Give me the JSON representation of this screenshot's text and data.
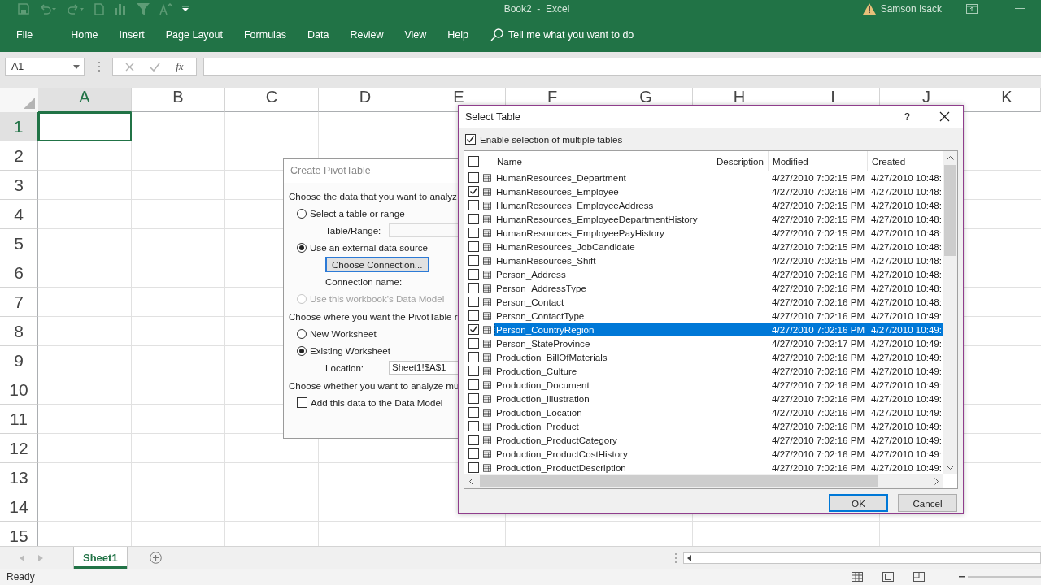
{
  "title_bar": {
    "title": "Book2  -  Excel",
    "user": "Samson Isack"
  },
  "ribbon_tabs": [
    "File",
    "Home",
    "Insert",
    "Page Layout",
    "Formulas",
    "Data",
    "Review",
    "View",
    "Help"
  ],
  "tell_me": {
    "placeholder": "Tell me what you want to do"
  },
  "formula_bar": {
    "name_box": "A1",
    "function_label": "fx"
  },
  "sheet": {
    "columns": [
      {
        "label": "A",
        "selected": true
      },
      {
        "label": "B",
        "selected": false
      },
      {
        "label": "C",
        "selected": false
      },
      {
        "label": "D",
        "selected": false
      },
      {
        "label": "E",
        "selected": false
      },
      {
        "label": "F",
        "selected": false
      },
      {
        "label": "G",
        "selected": false
      },
      {
        "label": "H",
        "selected": false
      },
      {
        "label": "I",
        "selected": false
      },
      {
        "label": "J",
        "selected": false
      },
      {
        "label": "K",
        "selected": false
      }
    ],
    "rows": [
      {
        "label": "1",
        "selected": true
      },
      {
        "label": "2",
        "selected": false
      },
      {
        "label": "3",
        "selected": false
      },
      {
        "label": "4",
        "selected": false
      },
      {
        "label": "5",
        "selected": false
      },
      {
        "label": "6",
        "selected": false
      },
      {
        "label": "7",
        "selected": false
      },
      {
        "label": "8",
        "selected": false
      },
      {
        "label": "9",
        "selected": false
      },
      {
        "label": "10",
        "selected": false
      },
      {
        "label": "11",
        "selected": false
      },
      {
        "label": "12",
        "selected": false
      },
      {
        "label": "13",
        "selected": false
      },
      {
        "label": "14",
        "selected": false
      },
      {
        "label": "15",
        "selected": false
      }
    ]
  },
  "sheet_tabs": [
    {
      "label": "Sheet1",
      "selected": true
    }
  ],
  "status_bar": {
    "text": "Ready"
  },
  "pivot_dialog": {
    "title": "Create PivotTable",
    "items": [
      {
        "kind": "heading",
        "text": "Choose the data that you want to analyz"
      },
      {
        "kind": "radio",
        "label": "Select a table or range",
        "selected": false,
        "disabled": false
      },
      {
        "kind": "field",
        "label": "Table/Range:",
        "disabled": true
      },
      {
        "kind": "radio",
        "label": "Use an external data source",
        "selected": true,
        "disabled": false
      },
      {
        "kind": "button",
        "label": "Choose Connection..."
      },
      {
        "kind": "note",
        "text": "Connection name:"
      },
      {
        "kind": "radio",
        "label": "Use this workbook's Data Model",
        "selected": false,
        "disabled": true
      },
      {
        "kind": "heading",
        "text": "Choose where you want the PivotTable r"
      },
      {
        "kind": "radio",
        "label": "New Worksheet",
        "selected": false,
        "disabled": false
      },
      {
        "kind": "radio",
        "label": "Existing Worksheet",
        "selected": true,
        "disabled": false
      },
      {
        "kind": "field",
        "label": "Location:",
        "value": "Sheet1!$A$1",
        "disabled": false
      },
      {
        "kind": "heading",
        "text": "Choose whether you want to analyze mu"
      },
      {
        "kind": "checkbox",
        "label": "Add this data to the Data Model",
        "checked": false
      }
    ]
  },
  "select_dialog": {
    "title": "Select Table",
    "help": "?",
    "multi_select": {
      "label": "Enable selection of multiple tables",
      "checked": true
    },
    "select_all": {
      "checked": false
    },
    "columns": [
      "Name",
      "Description",
      "Modified",
      "Created"
    ],
    "rows": [
      {
        "name": "HumanResources_Department",
        "modified": "4/27/2010 7:02:15 PM",
        "created": "4/27/2010 10:48:",
        "checked": false,
        "selected": false
      },
      {
        "name": "HumanResources_Employee",
        "modified": "4/27/2010 7:02:16 PM",
        "created": "4/27/2010 10:48:",
        "checked": true,
        "selected": false
      },
      {
        "name": "HumanResources_EmployeeAddress",
        "modified": "4/27/2010 7:02:15 PM",
        "created": "4/27/2010 10:48:",
        "checked": false,
        "selected": false
      },
      {
        "name": "HumanResources_EmployeeDepartmentHistory",
        "modified": "4/27/2010 7:02:15 PM",
        "created": "4/27/2010 10:48:",
        "checked": false,
        "selected": false
      },
      {
        "name": "HumanResources_EmployeePayHistory",
        "modified": "4/27/2010 7:02:15 PM",
        "created": "4/27/2010 10:48:",
        "checked": false,
        "selected": false
      },
      {
        "name": "HumanResources_JobCandidate",
        "modified": "4/27/2010 7:02:15 PM",
        "created": "4/27/2010 10:48:",
        "checked": false,
        "selected": false
      },
      {
        "name": "HumanResources_Shift",
        "modified": "4/27/2010 7:02:15 PM",
        "created": "4/27/2010 10:48:",
        "checked": false,
        "selected": false
      },
      {
        "name": "Person_Address",
        "modified": "4/27/2010 7:02:16 PM",
        "created": "4/27/2010 10:48:",
        "checked": false,
        "selected": false
      },
      {
        "name": "Person_AddressType",
        "modified": "4/27/2010 7:02:16 PM",
        "created": "4/27/2010 10:48:",
        "checked": false,
        "selected": false
      },
      {
        "name": "Person_Contact",
        "modified": "4/27/2010 7:02:16 PM",
        "created": "4/27/2010 10:48:",
        "checked": false,
        "selected": false
      },
      {
        "name": "Person_ContactType",
        "modified": "4/27/2010 7:02:16 PM",
        "created": "4/27/2010 10:49:",
        "checked": false,
        "selected": false
      },
      {
        "name": "Person_CountryRegion",
        "modified": "4/27/2010 7:02:16 PM",
        "created": "4/27/2010 10:49:",
        "checked": true,
        "selected": true
      },
      {
        "name": "Person_StateProvince",
        "modified": "4/27/2010 7:02:17 PM",
        "created": "4/27/2010 10:49:",
        "checked": false,
        "selected": false
      },
      {
        "name": "Production_BillOfMaterials",
        "modified": "4/27/2010 7:02:16 PM",
        "created": "4/27/2010 10:49:",
        "checked": false,
        "selected": false
      },
      {
        "name": "Production_Culture",
        "modified": "4/27/2010 7:02:16 PM",
        "created": "4/27/2010 10:49:",
        "checked": false,
        "selected": false
      },
      {
        "name": "Production_Document",
        "modified": "4/27/2010 7:02:16 PM",
        "created": "4/27/2010 10:49:",
        "checked": false,
        "selected": false
      },
      {
        "name": "Production_Illustration",
        "modified": "4/27/2010 7:02:16 PM",
        "created": "4/27/2010 10:49:",
        "checked": false,
        "selected": false
      },
      {
        "name": "Production_Location",
        "modified": "4/27/2010 7:02:16 PM",
        "created": "4/27/2010 10:49:",
        "checked": false,
        "selected": false
      },
      {
        "name": "Production_Product",
        "modified": "4/27/2010 7:02:16 PM",
        "created": "4/27/2010 10:49:",
        "checked": false,
        "selected": false
      },
      {
        "name": "Production_ProductCategory",
        "modified": "4/27/2010 7:02:16 PM",
        "created": "4/27/2010 10:49:",
        "checked": false,
        "selected": false
      },
      {
        "name": "Production_ProductCostHistory",
        "modified": "4/27/2010 7:02:16 PM",
        "created": "4/27/2010 10:49:",
        "checked": false,
        "selected": false
      },
      {
        "name": "Production_ProductDescription",
        "modified": "4/27/2010 7:02:16 PM",
        "created": "4/27/2010 10:49:",
        "checked": false,
        "selected": false
      }
    ],
    "buttons": [
      {
        "label": "OK",
        "default": true
      },
      {
        "label": "Cancel",
        "default": false
      }
    ]
  }
}
